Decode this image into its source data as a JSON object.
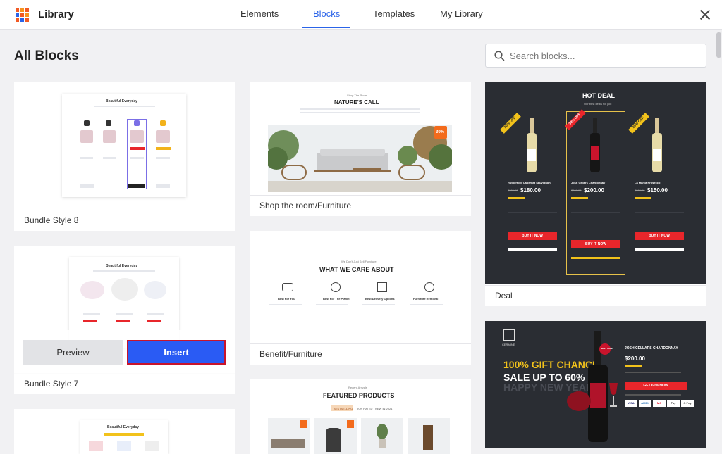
{
  "app": {
    "title": "Library"
  },
  "tabs": [
    {
      "label": "Elements"
    },
    {
      "label": "Blocks"
    },
    {
      "label": "Templates"
    },
    {
      "label": "My Library"
    }
  ],
  "active_tab": "Blocks",
  "heading": "All Blocks",
  "search": {
    "placeholder": "Search blocks...",
    "value": ""
  },
  "logo_colors": [
    "#f15a24",
    "#f7931e",
    "#f15a24",
    "#2a63e8",
    "#f15a24",
    "#f7931e",
    "#f15a24",
    "#2a63e8",
    "#f15a24"
  ],
  "accent_color": "#2a63e8",
  "insert_color": "#2a5bf4",
  "cards": {
    "bundle8": {
      "title": "Bundle Style 8",
      "preview_title": "Beautiful Everyday"
    },
    "bundle7": {
      "title": "Bundle Style 7",
      "preview_title": "Beautiful Everyday",
      "hover_preview": "Preview",
      "hover_insert": "Insert"
    },
    "bundle_third": {
      "preview_title": "Beautiful Everyday"
    },
    "shop_room": {
      "title": "Shop the room/Furniture",
      "preview_kicker": "Shop The Room",
      "preview_title": "NATURE'S CALL",
      "badge": "30%"
    },
    "benefit": {
      "title": "Benefit/Furniture",
      "preview_kicker": "We Don't Just Sell Furniture",
      "preview_title": "WHAT WE CARE ABOUT",
      "items": [
        "Best For You",
        "Best For The Planet",
        "Best Delivery Options",
        "Furniture Removal"
      ]
    },
    "featured": {
      "preview_kicker": "Recent Arrivals",
      "preview_title": "FEATURED PRODUCTS",
      "tabs": [
        "BESTSELLING",
        "TOP RATED",
        "NEW IN 2021"
      ]
    },
    "deal": {
      "title": "Deal",
      "preview_title": "HOT DEAL",
      "preview_sub": "Our best deals for you",
      "ribbon": "30% OFF",
      "products": [
        {
          "name": "Rutherford Cabernet Sauvignon",
          "old": "$200.00",
          "price": "$180.00"
        },
        {
          "name": "Josh Cellars Chardonnay",
          "old": "$200.00",
          "price": "$200.00"
        },
        {
          "name": "La Marca Prosecco",
          "old": "$200.00",
          "price": "$150.00"
        }
      ],
      "buy_label": "BUY IT NOW"
    },
    "chardonnay": {
      "brand": "CERMINE",
      "product": "JOSH CELLARS CHARDONNAY",
      "price": "$200.00",
      "headline1": "100% GIFT CHANCE",
      "headline2": "SALE UP TO 60%",
      "faded": "HAPPY NEW YEAR",
      "cta": "GET 60% NOW",
      "badge": "BEST SALE",
      "payments": [
        "VISA",
        "AMEX",
        "MC",
        "Pay",
        "G Pay"
      ]
    }
  }
}
